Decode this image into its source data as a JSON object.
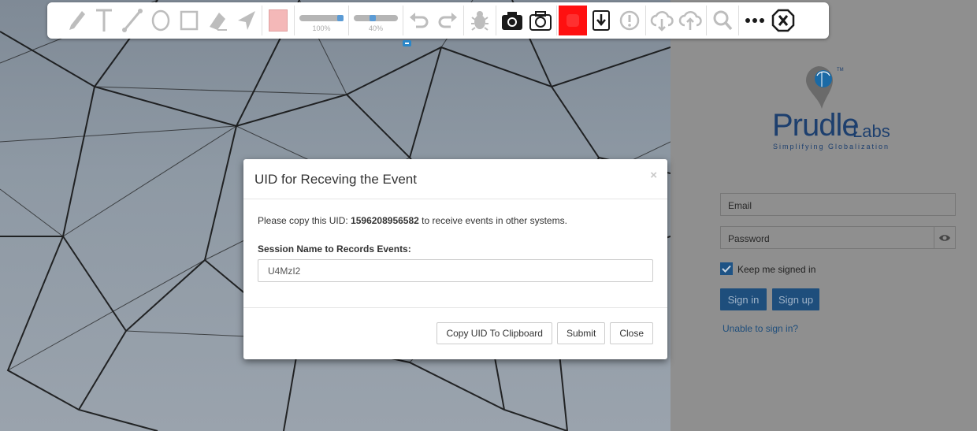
{
  "toolbar": {
    "tools": [
      "pencil-icon",
      "text-icon",
      "line-icon",
      "circle-icon",
      "rectangle-icon",
      "eraser-icon",
      "arrow-icon"
    ],
    "color": "#f4b8b8",
    "size_value": "100%",
    "opacity_value": "40%",
    "record_color": "#ff1010"
  },
  "brand": {
    "name": "Prudle",
    "suffix": "Labs",
    "tagline": "Simplifying Globalization",
    "color": "#1d3f6e"
  },
  "login": {
    "email_placeholder": "Email",
    "password_placeholder": "Password",
    "keep_signed_in": "Keep me signed in",
    "sign_in": "Sign in",
    "sign_up": "Sign up",
    "unable": "Unable to sign in?"
  },
  "modal": {
    "title": "UID for Receving the Event",
    "close_symbol": "×",
    "uid_prefix": "Please copy this UID: ",
    "uid": "1596208956582",
    "uid_suffix": " to receive events in other systems.",
    "session_label": "Session Name to Records Events:",
    "session_value": "U4MzI2",
    "copy_button": "Copy UID To Clipboard",
    "submit_button": "Submit",
    "close_button": "Close"
  }
}
